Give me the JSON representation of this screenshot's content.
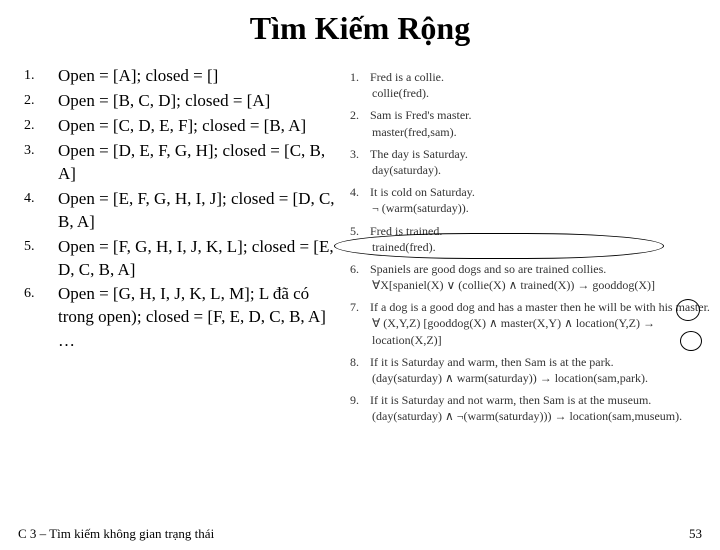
{
  "title": "Tìm Kiếm Rộng",
  "steps": [
    {
      "num": "1.",
      "text": "Open = [A]; closed = []"
    },
    {
      "num": "2.",
      "text": "Open = [B, C, D]; closed = [A]"
    },
    {
      "num": "2.",
      "text": "Open = [C, D, E, F]; closed = [B, A]"
    },
    {
      "num": "3.",
      "text": "Open = [D, E, F, G, H]; closed = [C, B, A]"
    },
    {
      "num": "4.",
      "text": "Open = [E, F, G, H, I, J]; closed = [D, C, B, A]"
    },
    {
      "num": "5.",
      "text": "Open = [F, G, H, I, J, K, L]; closed = [E, D, C, B, A]"
    },
    {
      "num": "6.",
      "text": "Open = [G, H, I, J, K, L, M]; L đã có trong open); closed = [F, E, D, C, B, A]"
    }
  ],
  "ellipsis": "…",
  "rules": [
    {
      "n": "1.",
      "line": "Fred is a collie.",
      "form": "collie(fred)."
    },
    {
      "n": "2.",
      "line": "Sam is Fred's master.",
      "form": "master(fred,sam)."
    },
    {
      "n": "3.",
      "line": "The day is Saturday.",
      "form": "day(saturday)."
    },
    {
      "n": "4.",
      "line": "It is cold on Saturday.",
      "form": "¬ (warm(saturday))."
    },
    {
      "n": "5.",
      "line": "Fred is trained.",
      "form": "trained(fred)."
    },
    {
      "n": "6.",
      "line": "Spaniels are good dogs and so are trained collies.",
      "form": "∀X[spaniel(X) ∨ (collie(X) ∧ trained(X)) → gooddog(X)]"
    },
    {
      "n": "7.",
      "line": "If a dog is a good dog and has a master then he will be with his master.",
      "form": "∀ (X,Y,Z) [gooddog(X) ∧ master(X,Y) ∧ location(Y,Z) → location(X,Z)]"
    },
    {
      "n": "8.",
      "line": "If it is Saturday and warm, then Sam is at the park.",
      "form": "(day(saturday) ∧ warm(saturday)) → location(sam,park)."
    },
    {
      "n": "9.",
      "line": "If it is Saturday and not warm, then Sam is at the museum.",
      "form": "(day(saturday) ∧ ¬(warm(saturday))) → location(sam,museum)."
    }
  ],
  "footer_left": "C 3 – Tìm kiếm không gian trạng thái",
  "footer_right": "53"
}
